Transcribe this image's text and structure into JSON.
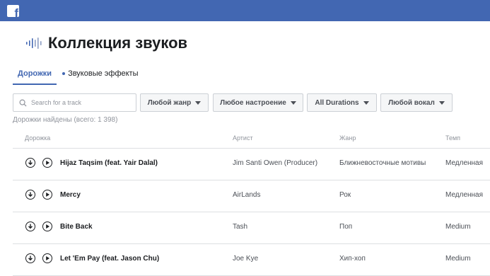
{
  "brand": {
    "logo_letter": "f"
  },
  "page": {
    "title": "Коллекция звуков"
  },
  "tabs": [
    {
      "label": "Дорожки",
      "active": true
    },
    {
      "label": "Звуковые эффекты",
      "active": false
    }
  ],
  "search": {
    "placeholder": "Search for a track",
    "value": ""
  },
  "filters": [
    {
      "label": "Любой жанр"
    },
    {
      "label": "Любое настроение"
    },
    {
      "label": "All Durations"
    },
    {
      "label": "Любой вокал"
    }
  ],
  "results": {
    "text": "Дорожки найдены (всего: 1 398)"
  },
  "table": {
    "columns": [
      "Дорожка",
      "Артист",
      "Жанр",
      "Темп"
    ],
    "rows": [
      {
        "track": "Hijaz Taqsim (feat. Yair Dalal)",
        "artist": "Jim Santi Owen (Producer)",
        "genre": "Ближневосточные мотивы",
        "tempo": "Медленная"
      },
      {
        "track": "Mercy",
        "artist": "AirLands",
        "genre": "Рок",
        "tempo": "Медленная"
      },
      {
        "track": "Bite Back",
        "artist": "Tash",
        "genre": "Поп",
        "tempo": "Medium"
      },
      {
        "track": "Let 'Em Pay (feat. Jason Chu)",
        "artist": "Joe Kye",
        "genre": "Хип-хоп",
        "tempo": "Medium"
      }
    ]
  },
  "colors": {
    "brand": "#4267b2",
    "text": "#1c1e21",
    "muted": "#90949c",
    "border": "#dddfe2"
  },
  "icons": {
    "logo": "facebook-logo",
    "title": "sound-wave-icon",
    "search": "search-icon",
    "download": "download-icon",
    "play": "play-icon",
    "caret": "caret-down-icon"
  }
}
